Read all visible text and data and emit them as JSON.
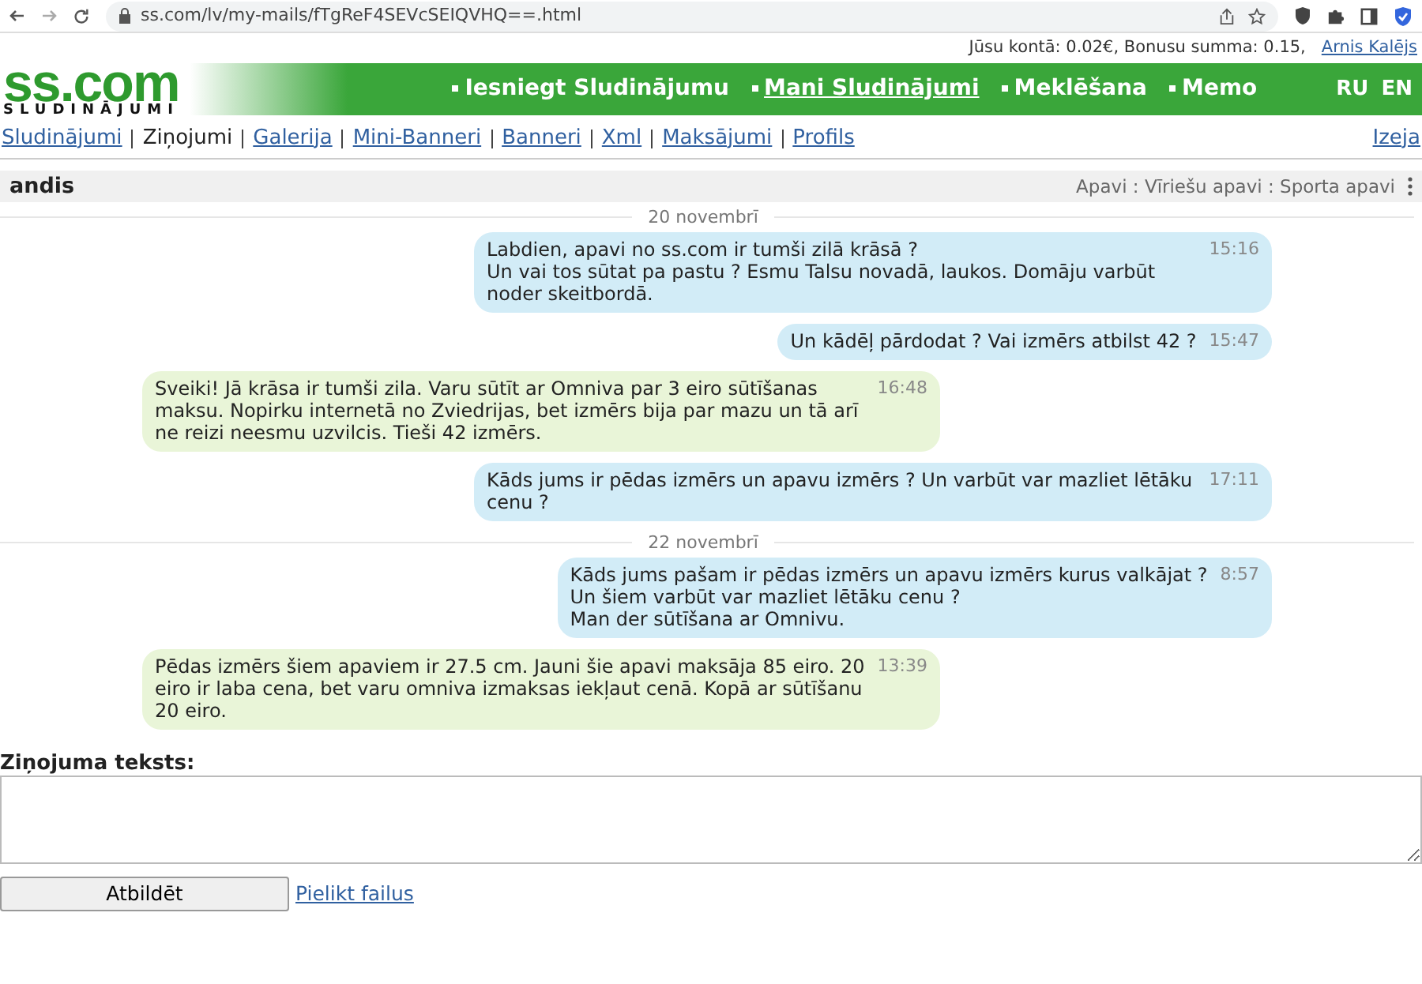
{
  "browser": {
    "url": "ss.com/lv/my-mails/fTgReF4SEVcSEIQVHQ==.html"
  },
  "account": {
    "balance_text": "Jūsu kontā: 0.02€, Bonusu summa: 0.15,",
    "user": "Arnis Kalējs"
  },
  "logo": {
    "title": "ss.com",
    "subtitle": "SLUDINĀJUMI"
  },
  "main_nav": [
    {
      "label": "Iesniegt Sludinājumu",
      "selected": false
    },
    {
      "label": "Mani Sludinājumi",
      "selected": true
    },
    {
      "label": "Meklēšana",
      "selected": false
    },
    {
      "label": "Memo",
      "selected": false
    }
  ],
  "languages": [
    "RU",
    "EN"
  ],
  "sub_nav": [
    {
      "label": "Sludinājumi",
      "selected": false
    },
    {
      "label": "Ziņojumi",
      "selected": true
    },
    {
      "label": "Galerija",
      "selected": false
    },
    {
      "label": "Mini-Banneri",
      "selected": false
    },
    {
      "label": "Banneri",
      "selected": false
    },
    {
      "label": "Xml",
      "selected": false
    },
    {
      "label": "Maksājumi",
      "selected": false
    },
    {
      "label": "Profils",
      "selected": false
    }
  ],
  "logout": "Izeja",
  "conversation": {
    "title": "andis",
    "breadcrumb": "Apavi : Vīriešu apavi : Sporta apavi"
  },
  "messages": [
    {
      "kind": "date",
      "text": "20 novembrī"
    },
    {
      "kind": "message",
      "outgoing": true,
      "lines": [
        "Labdien, apavi no ss.com ir tumši zilā krāsā ?",
        "Un vai tos sūtat pa pastu ? Esmu Talsu novadā, laukos. Domāju varbūt noder skeitbordā."
      ],
      "time": "15:16"
    },
    {
      "kind": "message",
      "outgoing": true,
      "lines": [
        "Un kādēļ pārdodat ? Vai izmērs atbilst 42 ?"
      ],
      "time": "15:47"
    },
    {
      "kind": "message",
      "outgoing": false,
      "lines": [
        "Sveiki! Jā krāsa ir tumši zila. Varu sūtīt ar Omniva par 3 eiro sūtīšanas maksu. Nopirku internetā no Zviedrijas, bet izmērs bija par mazu un tā arī ne reizi neesmu uzvilcis. Tieši 42 izmērs."
      ],
      "time": "16:48"
    },
    {
      "kind": "message",
      "outgoing": true,
      "lines": [
        "Kāds jums ir pēdas izmērs un apavu izmērs ? Un varbūt var mazliet lētāku cenu ?"
      ],
      "time": "17:11"
    },
    {
      "kind": "date",
      "text": "22 novembrī"
    },
    {
      "kind": "message",
      "outgoing": true,
      "lines": [
        "Kāds jums pašam ir pēdas izmērs un apavu izmērs kurus valkājat ?",
        "Un šiem varbūt var mazliet lētāku cenu ?",
        "Man der sūtīšana ar Omnivu."
      ],
      "time": "8:57"
    },
    {
      "kind": "message",
      "outgoing": false,
      "lines": [
        "Pēdas izmērs šiem apaviem ir 27.5 cm. Jauni šie apavi maksāja 85 eiro. 20 eiro ir laba cena, bet varu omniva izmaksas iekļaut cenā. Kopā ar sūtīšanu 20 eiro."
      ],
      "time": "13:39"
    }
  ],
  "compose": {
    "label": "Ziņojuma teksts:",
    "button": "Atbildēt",
    "attach_link": "Pielikt failus"
  }
}
